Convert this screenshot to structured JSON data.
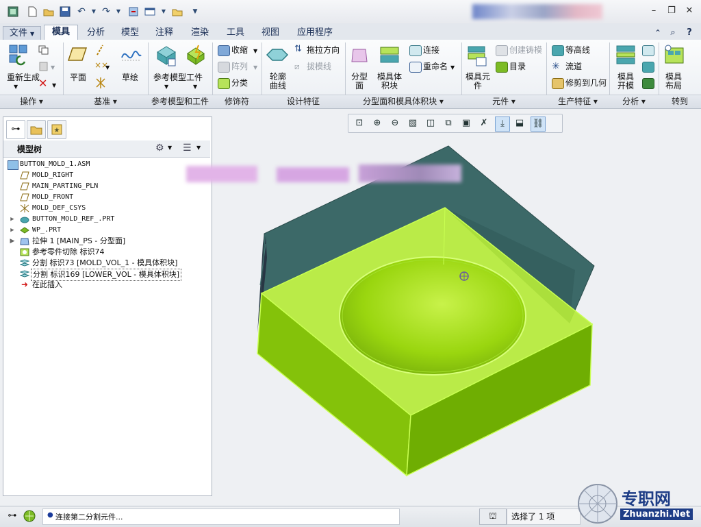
{
  "menus": {
    "file": "文件",
    "file_arrow": "▼"
  },
  "tabs": [
    "模具",
    "分析",
    "模型",
    "注释",
    "渲染",
    "工具",
    "视图",
    "应用程序"
  ],
  "ribbon": {
    "regenerate": "重新生成",
    "plane": "平面",
    "sketch": "草绘",
    "ref_model": "参考模型",
    "workpiece": "工件",
    "shrink": "收缩",
    "pattern": "阵列",
    "classify": "分类",
    "profile_curve": "轮廓曲线",
    "drag_direction": "拖拉方向",
    "draft_line": "拔模线",
    "parting_surface": "分型面",
    "mold_volume": "模具体积块",
    "connect": "连接",
    "rename": "重命名",
    "mold_component": "模具元件",
    "create_casting": "创建铸模",
    "catalog": "目录",
    "contour": "等高线",
    "runner": "流道",
    "trim_geometry": "修剪到几何",
    "mold_open": "模具开模",
    "mold_layout": "模具布局"
  },
  "groups": [
    "操作",
    "基准",
    "参考模型和工件",
    "修饰符",
    "设计特征",
    "分型面和模具体积块",
    "元件",
    "生产特征",
    "分析",
    "转到"
  ],
  "panel": {
    "title": "模型树"
  },
  "tree": [
    {
      "label": "BUTTON_MOLD_1.ASM"
    },
    {
      "label": "MOLD_RIGHT"
    },
    {
      "label": "MAIN_PARTING_PLN"
    },
    {
      "label": "MOLD_FRONT"
    },
    {
      "label": "MOLD_DEF_CSYS"
    },
    {
      "label": "BUTTON_MOLD_REF_.PRT"
    },
    {
      "label": "WP_.PRT"
    },
    {
      "label": "拉伸 1 [MAIN_PS - 分型面]"
    },
    {
      "label": "参考零件切除 标识74"
    },
    {
      "label": "分割 标识73 [MOLD_VOL_1 - 模具体积块]"
    },
    {
      "label": "分割 标识169 [LOWER_VOL - 模具体积块]"
    },
    {
      "label": "在此插入"
    }
  ],
  "status": {
    "message": "连接第二分割元件...",
    "selected": "选择了 1 项"
  },
  "watermark": {
    "brand": "专职网",
    "url": "Zhuanzhi.Net"
  },
  "colors": {
    "accent": "#1a3a7a",
    "solid": "#3d6b6a",
    "highlight": "#9ee00f"
  }
}
